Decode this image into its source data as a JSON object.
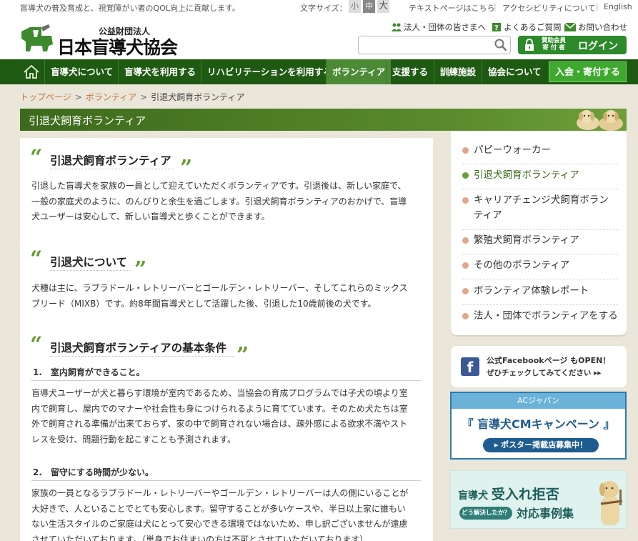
{
  "topbar": {
    "tagline": "盲導犬の普及育成と、視覚障がい者のQOL向上に貢献します。",
    "font_size_label": "文字サイズ：",
    "font_sizes": [
      "小",
      "中",
      "大"
    ],
    "links": [
      "テキストページはこちら",
      "アクセシビリティについて",
      "English"
    ]
  },
  "header": {
    "logo_sub": "公益財団法人",
    "logo_main": "日本盲導犬協会",
    "links": [
      "法人・団体の皆さまへ",
      "よくあるご質問",
      "お問い合わせ"
    ],
    "search_placeholder": "",
    "login_member": "賛助会員",
    "login_member2": "寄 付 者",
    "login_label": "ログイン"
  },
  "nav": {
    "items": [
      "盲導犬について",
      "盲導犬を利用する",
      "リハビリテーションを利用する",
      "ボランティア",
      "支援する",
      "訓練施設",
      "協会について"
    ],
    "join": "入会・寄付する"
  },
  "breadcrumb": {
    "home": "トップページ",
    "section": "ボランティア",
    "current": "引退犬飼育ボランティア"
  },
  "page_title": "引退犬飼育ボランティア",
  "main": {
    "sec1": {
      "heading": "引退犬飼育ボランティア",
      "lines": [
        "引退した盲導犬を家族の一員として迎えていただくボランティアです。引退後は、新しい家庭で、",
        "一般の家庭犬のように、のんびりと余生を過ごします。引退犬飼育ボランティアのおかげで、盲導",
        "犬ユーザーは安心して、新しい盲導犬と歩くことができます。"
      ]
    },
    "sec2": {
      "heading": "引退犬について",
      "lines": [
        "犬種は主に、ラブラドール・レトリーバーとゴールデン・レトリーバー、そしてこれらのミックス",
        "ブリード（MIXB）です。約8年間盲導犬として活躍した後、引退した10歳前後の犬です。"
      ]
    },
    "sec3": {
      "heading": "引退犬飼育ボランティアの基本条件",
      "cond1": {
        "heading": "1.　室内飼育ができること。",
        "lines": [
          "盲導犬ユーザーが犬と暮らす環境が室内であるため、当協会の育成プログラムでは子犬の頃より室",
          "内で飼育し、屋内でのマナーや社会性も身につけられるように育てています。そのため犬たちは室",
          "外で飼育される準備が出来ておらず、家の中で飼育されない場合は、疎外感による欲求不満やスト",
          "レスを受け、問題行動を起こすことも予測されます。"
        ]
      },
      "cond2": {
        "heading": "2.　留守にする時間が少ない。",
        "lines": [
          "家族の一員となるラブラドール・レトリーバーやゴールデン・レトリーバーは人の側にいることが",
          "大好きで、人といることでとても安心します。留守することが多いケースや、半日以上家に誰もい",
          "ない生活スタイルのご家庭は犬にとって安心できる環境ではないため、申し訳ございませんが遠慮",
          "させていただいております。（単身でお住まいの方は不可とさせていただいております）"
        ]
      }
    }
  },
  "side_menu": {
    "items": [
      {
        "label": "パピーウォーカー",
        "active": false
      },
      {
        "label": "引退犬飼育ボランティア",
        "active": true
      },
      {
        "label": "キャリアチェンジ犬飼育ボランティア",
        "active": false
      },
      {
        "label": "繁殖犬飼育ボランティア",
        "active": false
      },
      {
        "label": "その他のボランティア",
        "active": false
      },
      {
        "label": "ボランティア体験レポート",
        "active": false
      },
      {
        "label": "法人・団体でボランティアをする",
        "active": false
      }
    ]
  },
  "banners": {
    "facebook": {
      "line1": "公式Facebookページ もOPEN！",
      "line2": "ぜひチェックしてみてください ▸▸"
    },
    "ac": {
      "top": "ACジャパン",
      "title": "『 盲導犬CMキャンペーン 』",
      "button": "ポスター掲載店募集中！"
    },
    "reject": {
      "prefix": "盲導犬",
      "big": "受入れ拒否",
      "bubble": "どう解決したか？",
      "title": "対応事例集"
    }
  },
  "colors": {
    "nav_bg": "#1f5a12",
    "accent_green": "#3fa92f",
    "link_orange": "#c8713a",
    "quote_green": "#6a9a30"
  }
}
